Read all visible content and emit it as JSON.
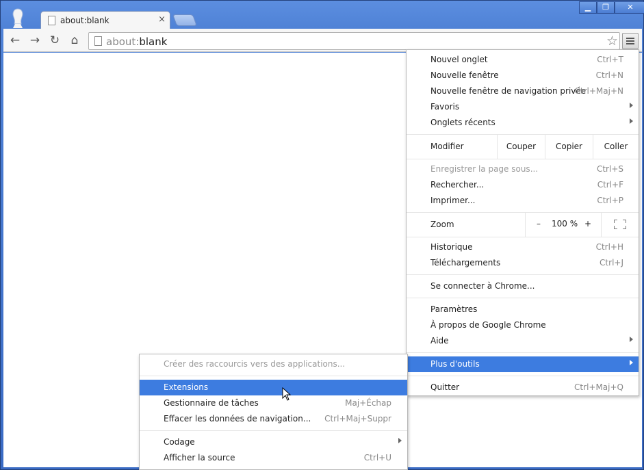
{
  "tab": {
    "title": "about:blank",
    "close": "×"
  },
  "window": {
    "minimize": "▁",
    "maximize": "❐",
    "close": "✕"
  },
  "toolbar": {
    "back": "←",
    "forward": "→",
    "reload": "↻",
    "home": "⌂",
    "url_scheme": "about:",
    "url_host": "blank",
    "bookmark_star": "☆"
  },
  "menu": {
    "items_top": [
      {
        "label": "Nouvel onglet",
        "shortcut": "Ctrl+T"
      },
      {
        "label": "Nouvelle fenêtre",
        "shortcut": "Ctrl+N"
      },
      {
        "label": "Nouvelle fenêtre de navigation privée",
        "shortcut": "Ctrl+Maj+N"
      },
      {
        "label": "Favoris",
        "shortcut": ""
      },
      {
        "label": "Onglets récents",
        "shortcut": ""
      }
    ],
    "edit": {
      "label": "Modifier",
      "cut": "Couper",
      "copy": "Copier",
      "paste": "Coller"
    },
    "items_page": [
      {
        "label": "Enregistrer la page sous...",
        "shortcut": "Ctrl+S"
      },
      {
        "label": "Rechercher...",
        "shortcut": "Ctrl+F"
      },
      {
        "label": "Imprimer...",
        "shortcut": "Ctrl+P"
      }
    ],
    "zoom": {
      "label": "Zoom",
      "minus": "–",
      "value": "100 %",
      "plus": "+"
    },
    "items_history": [
      {
        "label": "Historique",
        "shortcut": "Ctrl+H"
      },
      {
        "label": "Téléchargements",
        "shortcut": "Ctrl+J"
      }
    ],
    "signin": {
      "label": "Se connecter à Chrome..."
    },
    "items_settings": [
      {
        "label": "Paramètres"
      },
      {
        "label": "À propos de Google Chrome"
      },
      {
        "label": "Aide"
      }
    ],
    "more_tools": {
      "label": "Plus d'outils"
    },
    "quit": {
      "label": "Quitter",
      "shortcut": "Ctrl+Maj+Q"
    }
  },
  "submenu": {
    "create_shortcuts": {
      "label": "Créer des raccourcis vers des applications..."
    },
    "items_tools": [
      {
        "label": "Extensions",
        "shortcut": ""
      },
      {
        "label": "Gestionnaire de tâches",
        "shortcut": "Maj+Échap"
      },
      {
        "label": "Effacer les données de navigation...",
        "shortcut": "Ctrl+Maj+Suppr"
      }
    ],
    "items_dev": [
      {
        "label": "Codage",
        "shortcut": ""
      },
      {
        "label": "Afficher la source",
        "shortcut": "Ctrl+U"
      }
    ]
  }
}
